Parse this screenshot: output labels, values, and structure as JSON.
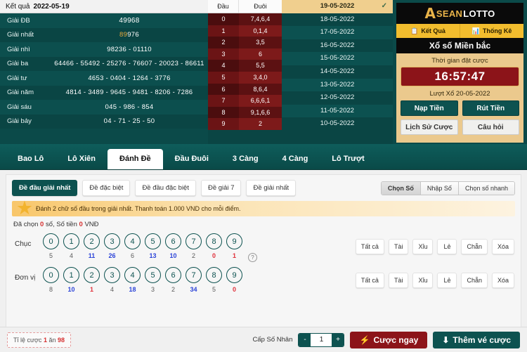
{
  "results": {
    "header_label": "Kết quả",
    "header_date": "2022-05-19",
    "rows": [
      {
        "name": "Giải ĐB",
        "value": "49968"
      },
      {
        "name": "Giải nhất",
        "value": "89976",
        "highlight": "89"
      },
      {
        "name": "Giải nhì",
        "value": "98236 - 01110"
      },
      {
        "name": "Giải ba",
        "value": "64466 - 55492 - 25276 - 76607 - 20023 - 86611"
      },
      {
        "name": "Giải tư",
        "value": "4653 - 0404 - 1264 - 3776"
      },
      {
        "name": "Giải năm",
        "value": "4814 - 3489 - 9645 - 9481 - 8206 - 7286"
      },
      {
        "name": "Giải sáu",
        "value": "045 - 986 - 854"
      },
      {
        "name": "Giải bảy",
        "value": "04 - 71 - 25 - 50"
      }
    ]
  },
  "head_tail": {
    "col1": "Đầu",
    "col2": "Đuôi",
    "rows": [
      {
        "head": "0",
        "tail": "7,4,6,4"
      },
      {
        "head": "1",
        "tail": "0,1,4"
      },
      {
        "head": "2",
        "tail": "3,5"
      },
      {
        "head": "3",
        "tail": "6"
      },
      {
        "head": "4",
        "tail": "5,5"
      },
      {
        "head": "5",
        "tail": "3,4,0"
      },
      {
        "head": "6",
        "tail": "8,6,4"
      },
      {
        "head": "7",
        "tail": "6,6,6,1"
      },
      {
        "head": "8",
        "tail": "9,1,6,6"
      },
      {
        "head": "9",
        "tail": "2"
      }
    ]
  },
  "dates": {
    "selected": "19-05-2022",
    "tick": "✓",
    "items": [
      "19-05-2022",
      "18-05-2022",
      "17-05-2022",
      "16-05-2022",
      "15-05-2022",
      "14-05-2022",
      "13-05-2022",
      "12-05-2022",
      "11-05-2022",
      "10-05-2022"
    ]
  },
  "brand": {
    "logo_a": "A",
    "logo_asean": "SEAN",
    "logo_lotto": "LOTTO",
    "tabs": [
      {
        "label": "Kết Quả",
        "icon": "clipboard-icon",
        "glyph": "📋"
      },
      {
        "label": "Thống Kê",
        "icon": "chart-icon",
        "glyph": "📊"
      }
    ],
    "title": "Xổ số Miền bắc",
    "bet_time_label": "Thời gian đặt cược",
    "countdown": "16:57:47",
    "draw_label": "Lượt Xổ",
    "draw_date": "20-05-2022",
    "buttons": [
      {
        "label": "Nạp Tiền",
        "style": "teal"
      },
      {
        "label": "Rút Tiền",
        "style": "teal"
      },
      {
        "label": "Lịch Sử Cược",
        "style": "light"
      },
      {
        "label": "Câu hỏi",
        "style": "light"
      }
    ]
  },
  "nav": {
    "active": "Đánh Đề",
    "tabs": [
      "Bao Lô",
      "Lô Xiên",
      "Đánh Đề",
      "Đầu Đuôi",
      "3 Càng",
      "4 Càng",
      "Lô Trượt"
    ]
  },
  "subtabs": {
    "active": "Đề đầu giải nhất",
    "items": [
      "Đề đầu giải nhất",
      "Đề đặc biệt",
      "Đề đầu đặc biệt",
      "Đề giải 7",
      "Đề giải nhất"
    ]
  },
  "modes": {
    "active": "Chọn Số",
    "items": [
      "Chọn Số",
      "Nhập Số",
      "Chọn số nhanh"
    ]
  },
  "notice": {
    "text": "Đánh 2 chữ số đầu trong giải nhất. Thanh toán 1.000 VND cho mỗi điểm.",
    "star_icon": "star-icon",
    "star_glyph": "★"
  },
  "chosen": {
    "prefix": "Đã chọn",
    "count": "0",
    "mid": "số,  Số tiền",
    "amount": "0",
    "suffix": "VNĐ"
  },
  "rows": [
    {
      "label": "Chục",
      "numbers": [
        "0",
        "1",
        "2",
        "3",
        "4",
        "5",
        "6",
        "7",
        "8",
        "9"
      ],
      "counts": [
        "5",
        "4",
        "11",
        "26",
        "6",
        "13",
        "10",
        "2",
        "0",
        "1"
      ],
      "count_colors": [
        "gray",
        "gray",
        "blue",
        "blue",
        "gray",
        "blue",
        "blue",
        "gray",
        "red",
        "red"
      ],
      "help_icon": "question-icon",
      "help_glyph": "?",
      "actions": [
        "Tất cả",
        "Tài",
        "Xỉu",
        "Lẻ",
        "Chẵn",
        "Xóa"
      ]
    },
    {
      "label": "Đơn vị",
      "numbers": [
        "0",
        "1",
        "2",
        "3",
        "4",
        "5",
        "6",
        "7",
        "8",
        "9"
      ],
      "counts": [
        "8",
        "10",
        "1",
        "4",
        "18",
        "3",
        "2",
        "34",
        "5",
        "0"
      ],
      "count_colors": [
        "gray",
        "blue",
        "red",
        "gray",
        "blue",
        "gray",
        "gray",
        "blue",
        "gray",
        "red"
      ],
      "actions": [
        "Tất cả",
        "Tài",
        "Xỉu",
        "Lẻ",
        "Chẵn",
        "Xóa"
      ]
    }
  ],
  "bottom": {
    "odds_prefix": "Tỉ lệ cược",
    "odds_one": "1",
    "odds_mid": "ăn",
    "odds_value": "98",
    "multiplier_label": "Cấp Số Nhân",
    "minus": "-",
    "multiplier_value": "1",
    "plus": "+",
    "bet_now": "Cược ngay",
    "bet_now_icon": "lightning-icon",
    "bet_now_glyph": "⚡",
    "add_ticket": "Thêm vé cược",
    "add_ticket_icon": "download-arrow-icon",
    "add_ticket_glyph": "⬇"
  },
  "colors": {
    "teal": "#0d5250",
    "dark_red": "#8c1419",
    "gold": "#f2bd2e",
    "blue_count": "#2b43d8",
    "red_count": "#e0303a"
  }
}
